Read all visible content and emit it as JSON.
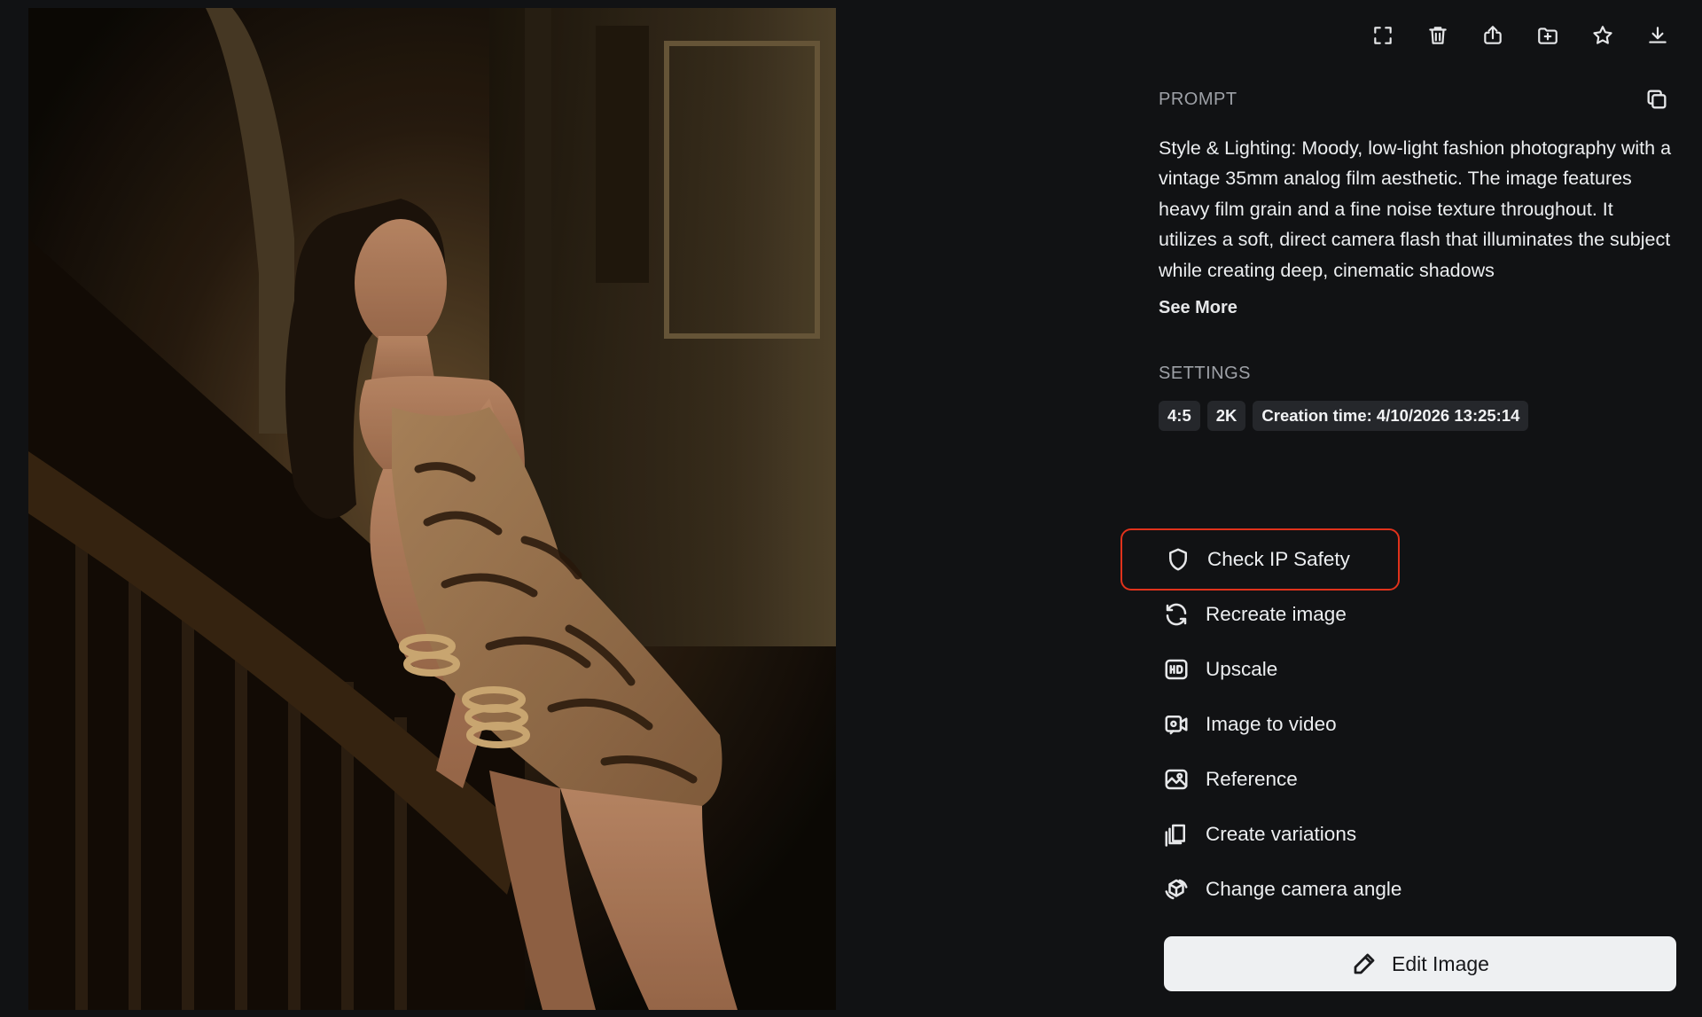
{
  "toolbar": {
    "items": [
      {
        "icon": "fullscreen-icon"
      },
      {
        "icon": "trash-icon"
      },
      {
        "icon": "share-icon"
      },
      {
        "icon": "add-to-folder-icon"
      },
      {
        "icon": "star-icon"
      },
      {
        "icon": "download-icon"
      }
    ]
  },
  "prompt": {
    "title": "PROMPT",
    "text": "Style & Lighting: Moody, low-light fashion photography with a vintage 35mm analog film aesthetic. The image features heavy film grain and a fine noise texture throughout. It utilizes a soft, direct camera flash that illuminates the subject while creating deep, cinematic shadows",
    "see_more": "See More"
  },
  "settings": {
    "title": "SETTINGS",
    "chips": [
      "4:5",
      "2K",
      "Creation time: 4/10/2026 13:25:14"
    ]
  },
  "actions": [
    {
      "label": "Check IP Safety",
      "icon": "shield-icon",
      "highlight": true
    },
    {
      "label": "Recreate image",
      "icon": "refresh-icon"
    },
    {
      "label": "Upscale",
      "icon": "hd-icon"
    },
    {
      "label": "Image to video",
      "icon": "video-icon"
    },
    {
      "label": "Reference",
      "icon": "image-reference-icon"
    },
    {
      "label": "Create variations",
      "icon": "layers-icon"
    },
    {
      "label": "Change camera angle",
      "icon": "camera-rotate-icon"
    }
  ],
  "edit": {
    "label": "Edit Image",
    "icon": "pencil-icon"
  },
  "colors": {
    "background": "#111214",
    "highlight": "#e0321b",
    "edit_button": "#eef0f2"
  }
}
